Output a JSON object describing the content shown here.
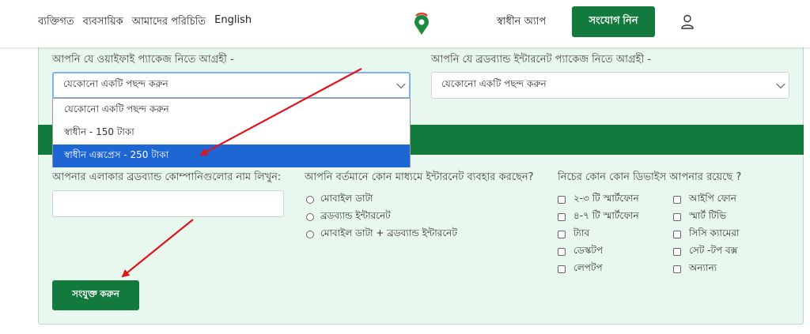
{
  "header": {
    "nav": [
      "ব্যক্তিগত",
      "ব্যবসায়িক",
      "আমাদের পরিচিতি",
      "English"
    ],
    "app_link": "স্বাধীন অ্যাপ",
    "connect_button": "সংযোগ নিন"
  },
  "form": {
    "wifi_label": "আপনি যে ওয়াইফাই প্যাকেজ নিতে আগ্রহী -",
    "wifi_select_value": "যেকোনো একটি পছন্দ করুন",
    "wifi_options": [
      "যেকোনো একটি পছন্দ করুন",
      "স্বাধীন - 150 টাকা",
      "স্বাধীন এক্সপ্রেস - 250 টাকা"
    ],
    "broadband_label": "আপনি যে ব্রডব্যান্ড ইন্টারনেট প্যাকেজ নিতে আগ্রহী -",
    "broadband_select_value": "যেকোনো একটি পছন্দ করুন",
    "company_label": "আপনার এলাকার ব্রডব্যান্ড কোম্পানিগুলোর নাম লিখুন:",
    "company_input_value": "",
    "medium_label": "আপনি বর্তমানে কোন মাধ্যমে ইন্টারনেট ব্যবহার করছেন?",
    "medium_options": [
      "মোবাইল ডাটা",
      "ব্রডব্যান্ড ইন্টারনেট",
      "মোবাইল ডাটা + ব্রডব্যান্ড ইন্টারনেট"
    ],
    "devices_label": "নিচের কোন কোন ডিভাইস আপনার রয়েছে ?",
    "devices_col1": [
      "২-৩ টি স্মার্টফোন",
      "৪-৭ টি স্মার্টফোন",
      "ট্যাব",
      "ডেস্কটপ",
      "লেপটপ"
    ],
    "devices_col2": [
      "আইপি ফোন",
      "স্মার্ট টিভি",
      "সিসি ক্যামেরা",
      "সেট -টপ বক্স",
      "অন্যান্য"
    ],
    "submit_button": "সংযুক্ত করুন"
  },
  "colors": {
    "brand_green": "#127a3c",
    "panel_bg": "#e9f8ee",
    "selected_option": "#1e66d4",
    "annotation_arrow": "#e0141e"
  }
}
